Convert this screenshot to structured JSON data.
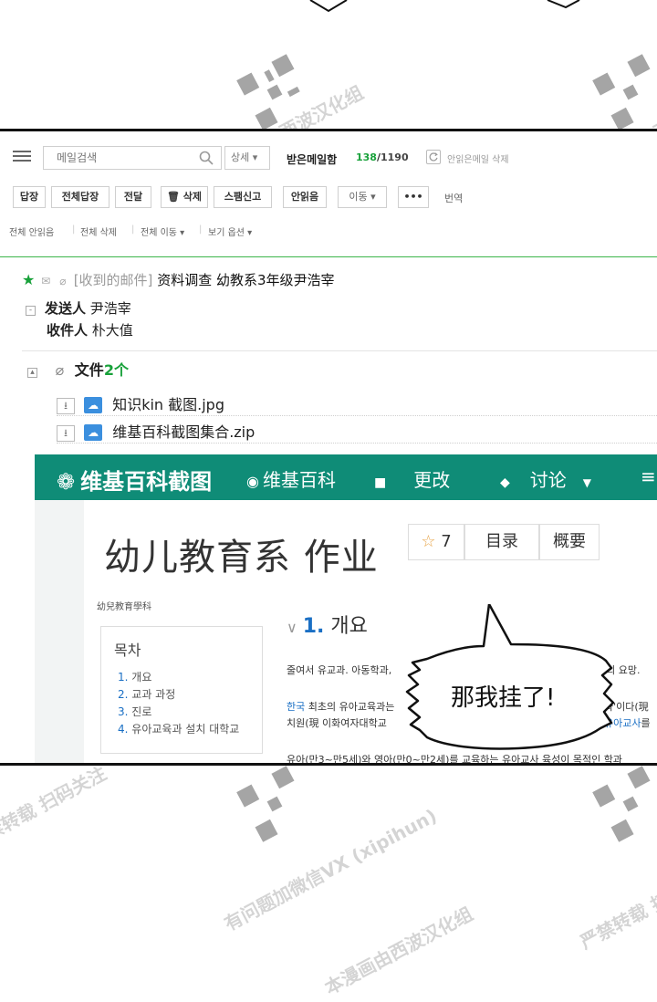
{
  "mail": {
    "toolbar": {
      "search_placeholder": "메일검색",
      "detail_label": "상세 ▾",
      "inbox_title": "받은메일함",
      "unread_count": "138",
      "total_count": "1190",
      "count_sep": "/",
      "delete_unread_label": "안읽은메일 삭제",
      "buttons": [
        "답장",
        "전체답장",
        "전달",
        "🗑 삭제",
        "스팸신고",
        "안읽음",
        "이동 ▾",
        "•••"
      ],
      "translate_label": "번역",
      "bulk": [
        "전체 안읽음",
        "전체 삭제",
        "전체 이동 ▾",
        "보기 옵션 ▾"
      ]
    },
    "message": {
      "folder_tag": "[收到的邮件]",
      "subject": "资料调查 幼教系3年级尹浩宰",
      "sender_label": "发送人",
      "sender": "尹浩宰",
      "recipient_label": "收件人",
      "recipient": "朴大值",
      "files_label": "文件",
      "files_count": "2个",
      "files": [
        "知识kin 截图.jpg",
        "维基百科截图集合.zip"
      ]
    }
  },
  "wiki": {
    "brand": "维基百科截图",
    "nav": [
      "维基百科",
      "更改",
      "讨论"
    ],
    "title": "幼儿教育系 作业",
    "star_count": "7",
    "tabs": [
      "目录",
      "概要"
    ],
    "subtitle": "幼兒教育學科",
    "toc_title": "목차",
    "toc": [
      {
        "n": "1.",
        "t": "개요"
      },
      {
        "n": "2.",
        "t": "교과 과정"
      },
      {
        "n": "3.",
        "t": "진로"
      },
      {
        "n": "4.",
        "t": "유아교육과 설치 대학교"
      }
    ],
    "section_num": "1.",
    "section_title": "개요",
    "text_line1": "줄여서 유교과. 아동학과,",
    "text_line1_end": "주의 요망.",
    "text_line2_link": "한국",
    "text_line2": "최초의 유아교육과는",
    "text_line2_end": "과'이다(現",
    "text_line3": "치원(現 이화여자대학교",
    "text_line3_link": "유아교사",
    "text_line3_end": "를",
    "text_line4": "유아(만3~만5세)와 영아(만0~만2세)를 교육하는 유아교사 육성이 목적인 학과"
  },
  "bubble": {
    "text": "那我挂了!"
  },
  "watermarks": {
    "line_a": "本漫画由西波汉化组",
    "line_b": "严禁转载 扫码关注",
    "line_c": "有问题加微信VX (xipihun)"
  }
}
